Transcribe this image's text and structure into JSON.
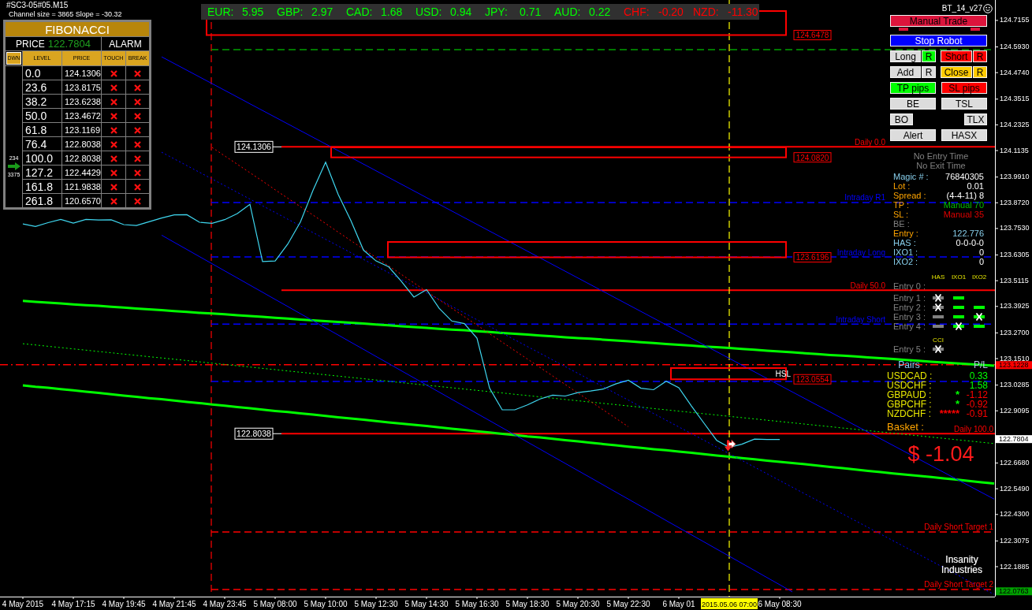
{
  "title": "#SC3-05#05.M15",
  "channel_info": "Channel size = 3865 Slope = -30.32",
  "fibonacci": {
    "title": "FIBONACCI",
    "price_label": "PRICE",
    "price": "122.7804",
    "alarm": "ALARM",
    "direction": "DWN",
    "columns": [
      "LEVEL",
      "PRICE",
      "TOUCH",
      "BREAK"
    ],
    "counts": [
      "234",
      "3375"
    ],
    "rows": [
      {
        "level": "0.0",
        "price": "124.1306",
        "touched": false,
        "broken": false
      },
      {
        "level": "23.6",
        "price": "123.8175",
        "touched": false,
        "broken": false
      },
      {
        "level": "38.2",
        "price": "123.6238",
        "touched": false,
        "broken": false
      },
      {
        "level": "50.0",
        "price": "123.4672",
        "touched": false,
        "broken": false
      },
      {
        "level": "61.8",
        "price": "123.1169",
        "touched": false,
        "broken": false
      },
      {
        "level": "76.4",
        "price": "122.8038",
        "touched": false,
        "broken": false
      },
      {
        "level": "100.0",
        "price": "122.8038",
        "touched": false,
        "broken": false
      },
      {
        "level": "127.2",
        "price": "122.4429",
        "touched": false,
        "broken": false
      },
      {
        "level": "161.8",
        "price": "121.9838",
        "touched": false,
        "broken": false
      },
      {
        "level": "261.8",
        "price": "120.6570",
        "touched": false,
        "broken": false
      }
    ]
  },
  "currency_strength": [
    {
      "currency": "EUR:",
      "value": "5.95",
      "color": "#00ff00"
    },
    {
      "currency": "GBP:",
      "value": "2.97",
      "color": "#00ff00"
    },
    {
      "currency": "CAD:",
      "value": "1.68",
      "color": "#00ff00"
    },
    {
      "currency": "USD:",
      "value": "0.94",
      "color": "#00ff00"
    },
    {
      "currency": "JPY:",
      "value": "0.71",
      "color": "#00ff00"
    },
    {
      "currency": "AUD:",
      "value": "0.22",
      "color": "#00ff00"
    },
    {
      "currency": "CHF:",
      "value": "-0.20",
      "color": "#ff0000"
    },
    {
      "currency": "NZD:",
      "value": "-11.30",
      "color": "#ff0000"
    }
  ],
  "robot": {
    "version": "BT_14_v27",
    "button_rows": [
      {
        "kind": "full",
        "buttons": [
          {
            "label": "Manual Trade",
            "color": "#dc143c",
            "active": true
          }
        ]
      },
      {
        "kind": "full",
        "buttons": [
          {
            "label": "Stop Robot",
            "color": "#0000ff",
            "active": false
          }
        ]
      },
      {
        "kind": "split",
        "buttons": [
          {
            "label": "Long",
            "color": "#dcdcdc",
            "active": false
          },
          {
            "label": "R",
            "color": "#00ff00",
            "active": false
          },
          {
            "label": "Short",
            "color": "#ff0000",
            "active": false
          },
          {
            "label": "R",
            "color": "#ff0000",
            "active": false
          }
        ]
      },
      {
        "kind": "split",
        "buttons": [
          {
            "label": "Add",
            "color": "#dcdcdc",
            "active": false
          },
          {
            "label": "R",
            "color": "#dcdcdc",
            "active": false
          },
          {
            "label": "Close",
            "color": "#ffcc00",
            "active": false
          },
          {
            "label": "R",
            "color": "#ffcc00",
            "active": false
          }
        ]
      },
      {
        "kind": "pair",
        "buttons": [
          {
            "label": "TP pips",
            "color": "#00ff00",
            "active": false
          },
          {
            "label": "SL pips",
            "color": "#ff0000",
            "active": false
          }
        ]
      },
      {
        "kind": "pair",
        "buttons": [
          {
            "label": "BE",
            "color": "#dcdcdc",
            "active": false
          },
          {
            "label": "TSL",
            "color": "#dcdcdc",
            "active": false
          }
        ]
      },
      {
        "kind": "compact",
        "buttons": [
          {
            "label": "BO",
            "color": "#dcdcdc",
            "active": false
          },
          {
            "label": "TLX",
            "color": "#dcdcdc",
            "active": false
          }
        ]
      },
      {
        "kind": "pair",
        "buttons": [
          {
            "label": "Alert",
            "color": "#dcdcdc",
            "active": false
          },
          {
            "label": "HASX",
            "color": "#dcdcdc",
            "active": false
          }
        ]
      }
    ],
    "times": [
      "No Entry Time",
      "No Exit Time"
    ],
    "info": [
      {
        "kind": "identity",
        "label": "Magic # :",
        "value": "76840305"
      },
      {
        "kind": "setting",
        "label": "Lot :",
        "value": "0.01"
      },
      {
        "kind": "setting",
        "label": "Spread :",
        "value": "(4-4-11) 8"
      },
      {
        "kind": "target",
        "label": "TP :",
        "value": "Manual 70"
      },
      {
        "kind": "stop",
        "label": "SL :",
        "value": "Manual 35"
      },
      {
        "kind": "inactive",
        "label": "BE :"
      },
      {
        "kind": "entry",
        "label": "Entry :",
        "value": "122.776"
      },
      {
        "kind": "identity",
        "label": "HAS :",
        "value": "0-0-0-0"
      },
      {
        "kind": "identity",
        "label": "IXO1 :",
        "value": "0"
      },
      {
        "kind": "identity",
        "label": "IXO2 :",
        "value": "0"
      }
    ],
    "signal_groups": [
      {
        "headers": [
          "HAS",
          "IXO1",
          "IXO2"
        ],
        "entries": [
          {
            "label": "Entry 0 :",
            "cells": [
              {
                "kind": "empty"
              },
              {
                "kind": "empty"
              },
              {
                "kind": "empty"
              }
            ]
          },
          {
            "label": "Entry 1 :",
            "cells": [
              {
                "kind": "bar-cross",
                "color": "#808080"
              },
              {
                "kind": "bar",
                "color": "#00ff00"
              },
              {
                "kind": "empty"
              }
            ]
          },
          {
            "label": "Entry 2 :",
            "cells": [
              {
                "kind": "bar-cross",
                "color": "#808080"
              },
              {
                "kind": "bar",
                "color": "#00ff00"
              },
              {
                "kind": "bar",
                "color": "#00ff00"
              }
            ]
          },
          {
            "label": "Entry 3 :",
            "cells": [
              {
                "kind": "bar",
                "color": "#808080"
              },
              {
                "kind": "bar",
                "color": "#00ff00"
              },
              {
                "kind": "bar-cross",
                "color": "#00ff00"
              }
            ]
          },
          {
            "label": "Entry 4 :",
            "cells": [
              {
                "kind": "bar",
                "color": "#808080"
              },
              {
                "kind": "bar-cross",
                "color": "#00ff00"
              },
              {
                "kind": "bar",
                "color": "#00ff00"
              }
            ]
          }
        ]
      },
      {
        "headers": [
          "CCI"
        ],
        "entries": [
          {
            "label": "Entry 5 :",
            "cells": [
              {
                "kind": "bar-cross",
                "color": "#808080"
              }
            ]
          }
        ]
      }
    ],
    "pairs": {
      "heading": "Pairs",
      "pl_heading": "P/L",
      "rows": [
        {
          "pair": "USDCAD :",
          "pl": "0.33",
          "loss": false
        },
        {
          "pair": "USDCHF :",
          "pl": "1.58",
          "loss": false
        },
        {
          "pair": "GBPAUD :",
          "marker": {
            "text": "*",
            "color": "#00ff00"
          },
          "pl": "-1.12",
          "loss": true
        },
        {
          "pair": "GBPCHF :",
          "marker": {
            "text": "*",
            "color": "#00ff00"
          },
          "pl": "-0.92",
          "loss": true
        },
        {
          "pair": "NZDCHF :",
          "marker": {
            "text": "*****",
            "color": "#ff0000"
          },
          "pl": "-0.91",
          "loss": true
        }
      ]
    },
    "basket": {
      "label": "Basket :",
      "total": "$ -1.04"
    }
  },
  "logo": [
    "Insanity",
    "Industries"
  ],
  "chart": {
    "level_tags": [
      "124.1306",
      "122.8038"
    ],
    "zone_tags": [
      "124.6478",
      "124.0820",
      "123.6196",
      "123.0554"
    ],
    "price_markers": [
      {
        "label": "122.7804",
        "color": "#ffffff"
      },
      {
        "label": "122.0763",
        "color": "#00a000"
      }
    ],
    "chart_data": {
      "type": "line",
      "categories": [
        "4 May 2015",
        null,
        null,
        null,
        "4 May 17:15",
        null,
        null,
        null,
        "4 May 19:45",
        null,
        null,
        null,
        "4 May 21:45",
        null,
        null,
        null,
        "4 May 23:45",
        null,
        null,
        null,
        "5 May 08:00",
        null,
        null,
        null,
        "5 May 10:00",
        null,
        null,
        null,
        "5 May 12:30",
        null,
        null,
        null,
        "5 May 14:30",
        null,
        null,
        null,
        "5 May 16:30",
        null,
        null,
        null,
        "5 May 18:30",
        null,
        null,
        null,
        "5 May 20:30",
        null,
        null,
        null,
        "5 May 22:30",
        null,
        null,
        null,
        "6 May 01",
        null,
        null,
        null,
        "2015.05.06 07:00",
        null,
        null,
        null,
        "6 May 08:30",
        null,
        null,
        null,
        null,
        null,
        null,
        null,
        null,
        null,
        null,
        null,
        null,
        null,
        null,
        null,
        null,
        null
      ],
      "ylim": [
        122.05,
        124.81
      ],
      "yticks": [
        {
          "value": 124.7155,
          "label": "124.7155"
        },
        {
          "value": 124.593,
          "label": "124.5930"
        },
        {
          "value": 124.474,
          "label": "124.4740"
        },
        {
          "value": 124.3515,
          "label": "124.3515"
        },
        {
          "value": 124.2325,
          "label": "124.2325"
        },
        {
          "value": 124.1135,
          "label": "124.1135"
        },
        {
          "value": 123.991,
          "label": "123.9910"
        },
        {
          "value": 123.872,
          "label": "123.8720"
        },
        {
          "value": 123.753,
          "label": "123.7530"
        },
        {
          "value": 123.6305,
          "label": "123.6305"
        },
        {
          "value": 123.5115,
          "label": "123.5115"
        },
        {
          "value": 123.3925,
          "label": "123.3925"
        },
        {
          "value": 123.27,
          "label": "123.2700"
        },
        {
          "value": 123.151,
          "label": "123.1510"
        },
        {
          "value": 123.0285,
          "label": "123.0285"
        },
        {
          "value": 122.9095,
          "label": "122.9095"
        },
        {
          "value": 122.668,
          "label": "122.6680"
        },
        {
          "value": 122.549,
          "label": "122.5490"
        },
        {
          "value": 122.43,
          "label": "122.4300"
        },
        {
          "value": 122.3075,
          "label": "122.3075"
        },
        {
          "value": 122.1885,
          "label": "122.1885"
        }
      ],
      "series": [
        {
          "color": "#3fd7f0",
          "values": [
            123.774,
            123.762,
            123.78,
            123.795,
            123.778,
            123.795,
            123.792,
            123.793,
            123.771,
            123.767,
            123.784,
            123.801,
            123.816,
            123.817,
            123.782,
            123.777,
            123.794,
            123.822,
            123.865,
            123.6,
            123.603,
            123.681,
            123.783,
            123.929,
            124.06,
            123.91,
            123.79,
            123.653,
            123.603,
            123.576,
            123.509,
            123.436,
            123.47,
            123.384,
            123.325,
            123.313,
            123.246,
            123.014,
            122.914,
            122.914,
            122.937,
            122.964,
            122.982,
            122.978,
            122.994,
            123.001,
            123.01,
            123.034,
            123.051,
            123.014,
            123.007,
            123.046,
            123.016,
            122.932,
            122.852,
            122.773,
            122.741,
            122.755,
            122.779,
            122.777,
            122.777,
            null,
            null,
            null,
            null,
            null,
            null,
            null,
            null,
            null,
            null,
            null,
            null,
            null,
            null,
            null,
            null,
            null
          ]
        },
        {
          "color": "#00ff00",
          "line_style": "solid",
          "values": [
            123.418,
            123.414,
            123.41,
            123.406,
            123.402,
            123.398,
            123.395,
            123.391,
            123.387,
            123.383,
            123.379,
            123.375,
            123.371,
            123.367,
            123.363,
            123.36,
            123.356,
            123.352,
            123.348,
            123.344,
            123.34,
            123.336,
            123.332,
            123.328,
            123.324,
            123.321,
            123.317,
            123.313,
            123.309,
            123.305,
            123.301,
            123.297,
            123.293,
            123.289,
            123.285,
            123.282,
            123.278,
            123.274,
            123.27,
            123.266,
            123.262,
            123.258,
            123.254,
            123.25,
            123.246,
            123.243,
            123.239,
            123.235,
            123.231,
            123.227,
            123.223,
            123.219,
            123.215,
            123.211,
            123.207,
            123.204,
            123.2,
            123.196,
            123.192,
            123.188,
            123.184,
            123.18,
            123.176,
            123.172,
            123.168,
            123.165,
            123.161,
            123.157,
            123.153,
            123.149,
            123.145,
            123.141,
            123.137,
            123.133,
            123.129,
            123.126,
            123.122,
            123.118
          ]
        },
        {
          "color": "#00ff00",
          "line_style": "solid",
          "values": [
            123.027,
            123.021,
            123.016,
            123.01,
            123.004,
            122.998,
            122.992,
            122.986,
            122.98,
            122.974,
            122.968,
            122.963,
            122.957,
            122.951,
            122.945,
            122.939,
            122.933,
            122.927,
            122.921,
            122.915,
            122.909,
            122.904,
            122.898,
            122.892,
            122.886,
            122.88,
            122.874,
            122.868,
            122.862,
            122.856,
            122.85,
            122.845,
            122.839,
            122.833,
            122.827,
            122.821,
            122.815,
            122.809,
            122.803,
            122.797,
            122.791,
            122.786,
            122.78,
            122.774,
            122.768,
            122.762,
            122.756,
            122.75,
            122.744,
            122.738,
            122.732,
            122.727,
            122.721,
            122.715,
            122.709,
            122.703,
            122.697,
            122.691,
            122.685,
            122.679,
            122.673,
            122.668,
            122.662,
            122.656,
            122.65,
            122.644,
            122.638,
            122.632,
            122.626,
            122.62,
            122.614,
            122.609,
            122.603,
            122.597,
            122.591,
            122.585,
            122.579,
            122.573
          ]
        },
        {
          "color": "#00ff00",
          "line_style": "dotted",
          "values": [
            123.22,
            123.214,
            123.208,
            123.202,
            123.196,
            123.19,
            123.184,
            123.178,
            123.172,
            123.166,
            123.16,
            123.154,
            123.148,
            123.142,
            123.136,
            123.13,
            123.124,
            123.118,
            123.112,
            123.106,
            123.1,
            123.094,
            123.088,
            123.082,
            123.076,
            123.07,
            123.064,
            123.058,
            123.052,
            123.046,
            123.04,
            123.034,
            123.028,
            123.022,
            123.016,
            123.01,
            123.004,
            122.998,
            122.992,
            122.986,
            122.98,
            122.974,
            122.968,
            122.962,
            122.956,
            122.95,
            122.944,
            122.938,
            122.932,
            122.926,
            122.92,
            122.914,
            122.908,
            122.902,
            122.896,
            122.89,
            122.884,
            122.878,
            122.872,
            122.866,
            122.86,
            122.854,
            122.848,
            122.842,
            122.836,
            122.83,
            122.824,
            122.818,
            122.812,
            122.806,
            122.8,
            122.794,
            122.788,
            122.782,
            122.776,
            122.77,
            122.764,
            122.758
          ]
        },
        {
          "color": "#0000ff",
          "line_style": "solid",
          "values": [
            null,
            null,
            null,
            null,
            null,
            null,
            null,
            null,
            null,
            null,
            null,
            124.547,
            124.516,
            124.485,
            124.454,
            124.423,
            124.392,
            124.361,
            124.33,
            124.299,
            124.268,
            124.237,
            124.206,
            124.175,
            124.144,
            124.113,
            124.082,
            124.051,
            124.02,
            123.989,
            123.958,
            123.927,
            123.896,
            123.865,
            123.834,
            123.803,
            123.772,
            123.741,
            123.71,
            123.679,
            123.648,
            123.617,
            123.586,
            123.555,
            123.524,
            123.493,
            123.462,
            123.431,
            123.4,
            123.369,
            123.338,
            123.307,
            123.276,
            123.245,
            123.214,
            123.183,
            123.152,
            123.121,
            123.09,
            123.059,
            123.028,
            122.997,
            122.966,
            122.935,
            122.904,
            122.873,
            122.842,
            122.811,
            122.78,
            122.749,
            122.718,
            122.687,
            122.656,
            122.625,
            122.594,
            122.563,
            122.532,
            122.501
          ]
        },
        {
          "color": "#0000ff",
          "line_style": "dotted",
          "values": [
            null,
            null,
            null,
            null,
            null,
            null,
            null,
            null,
            null,
            null,
            null,
            124.106,
            124.075,
            124.044,
            124.013,
            123.982,
            123.951,
            123.92,
            123.889,
            123.858,
            123.827,
            123.796,
            123.765,
            123.734,
            123.703,
            123.672,
            123.641,
            123.61,
            123.579,
            123.548,
            123.517,
            123.486,
            123.455,
            123.424,
            123.393,
            123.362,
            123.331,
            123.3,
            123.269,
            123.238,
            123.207,
            123.176,
            123.145,
            123.114,
            123.083,
            123.052,
            123.021,
            122.99,
            122.959,
            122.928,
            122.897,
            122.866,
            122.835,
            122.804,
            122.773,
            122.742,
            122.711,
            122.68,
            122.649,
            122.618,
            122.587,
            122.556,
            122.525,
            122.494,
            122.463,
            122.432,
            122.401,
            122.37,
            122.339,
            122.308,
            122.277,
            122.246,
            122.215,
            122.184,
            122.153,
            122.122,
            122.091,
            122.06
          ]
        },
        {
          "color": "#0000ff",
          "line_style": "solid",
          "values": [
            null,
            null,
            null,
            null,
            null,
            null,
            null,
            null,
            null,
            null,
            null,
            123.722,
            123.689,
            123.656,
            123.623,
            123.59,
            123.557,
            123.524,
            123.491,
            123.458,
            123.425,
            123.392,
            123.359,
            123.326,
            123.293,
            123.26,
            123.227,
            123.194,
            123.161,
            123.128,
            123.095,
            123.062,
            123.029,
            122.996,
            122.963,
            122.93,
            122.897,
            122.864,
            122.831,
            122.798,
            122.765,
            122.732,
            122.699,
            122.666,
            122.633,
            122.6,
            122.567,
            122.534,
            122.501,
            122.468,
            122.435,
            122.402,
            122.369,
            122.336,
            122.303,
            122.27,
            122.237,
            122.204,
            122.171,
            122.138,
            122.105,
            122.072,
            null,
            null,
            null,
            null,
            null,
            null,
            null,
            null,
            null,
            null,
            null,
            null,
            null,
            null,
            null,
            null
          ]
        },
        {
          "color": "#ff0000",
          "line_style": "dotted",
          "values": [
            null,
            null,
            null,
            null,
            null,
            null,
            null,
            null,
            null,
            null,
            null,
            null,
            null,
            null,
            null,
            124.128,
            124.089,
            124.05,
            124.011,
            123.972,
            123.932,
            123.893,
            123.854,
            123.815,
            123.776,
            123.736,
            123.697,
            123.658,
            123.619,
            123.58,
            123.541,
            123.501,
            123.462,
            123.423,
            123.384,
            123.345,
            123.306,
            123.266,
            123.227,
            123.188,
            123.149,
            123.11,
            123.071,
            123.031,
            122.992,
            122.953,
            122.914,
            122.875,
            122.836,
            null,
            null,
            null,
            null,
            null,
            null,
            null,
            null,
            null,
            null,
            null,
            null,
            null,
            null,
            null,
            null,
            null,
            null,
            null,
            null,
            null,
            null,
            null,
            null,
            null,
            null,
            null,
            null,
            null
          ]
        }
      ],
      "ref_lines": [
        {
          "axis": "y",
          "value": 124.58,
          "color": "#00a000",
          "line_style": "dashed"
        },
        {
          "axis": "y",
          "value": 124.1306,
          "label": "Daily 0.0",
          "color": "#ff0000",
          "line_style": "solid"
        },
        {
          "axis": "y",
          "value": 123.873,
          "label": "Intraday R1",
          "color": "#0000ff",
          "line_style": "dashed"
        },
        {
          "axis": "y",
          "value": 123.621,
          "label": "Intraday Long",
          "color": "#0000ff",
          "line_style": "dashed"
        },
        {
          "axis": "y",
          "value": 123.4672,
          "label": "Daily 50.0",
          "color": "#ff0000",
          "line_style": "solid"
        },
        {
          "axis": "y",
          "value": 123.311,
          "label": "Intraday Short",
          "color": "#0000ff",
          "line_style": "dashed"
        },
        {
          "axis": "y",
          "value": 123.1228,
          "label": "123.1228",
          "color": "#ff0000",
          "line_style": "dashdot"
        },
        {
          "axis": "y",
          "value": 123.045,
          "color": "#0000ff",
          "line_style": "dashed"
        },
        {
          "axis": "y",
          "value": 122.8038,
          "label": "Daily 100.0",
          "color": "#ff0000",
          "line_style": "solid"
        },
        {
          "axis": "y",
          "value": 122.349,
          "label": "Daily Short Target 1",
          "color": "#ff0000",
          "line_style": "dashed"
        },
        {
          "axis": "y",
          "value": 122.083,
          "label": "Daily Short Target 2",
          "color": "#ff0000",
          "line_style": "dashed"
        },
        {
          "axis": "x",
          "value": "2015.05.06 07:00",
          "color": "#ffff00",
          "line_style": "dashed"
        }
      ],
      "annotations": [
        "HSL"
      ]
    }
  }
}
